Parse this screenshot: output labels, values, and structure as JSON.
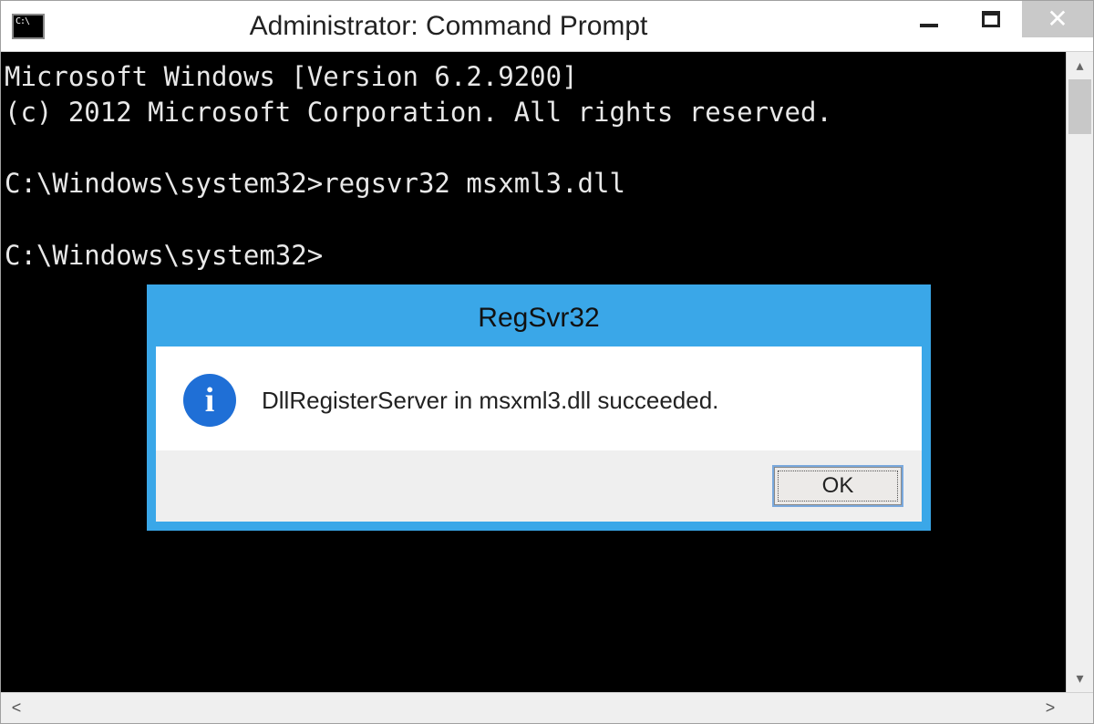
{
  "window": {
    "title": "Administrator: Command Prompt"
  },
  "terminal": {
    "line1": "Microsoft Windows [Version 6.2.9200]",
    "line2": "(c) 2012 Microsoft Corporation. All rights reserved.",
    "blank1": "",
    "line3": "C:\\Windows\\system32>regsvr32 msxml3.dll",
    "blank2": "",
    "line4": "C:\\Windows\\system32>"
  },
  "dialog": {
    "title": "RegSvr32",
    "message": "DllRegisterServer in msxml3.dll succeeded.",
    "ok_label": "OK",
    "info_glyph": "i"
  }
}
